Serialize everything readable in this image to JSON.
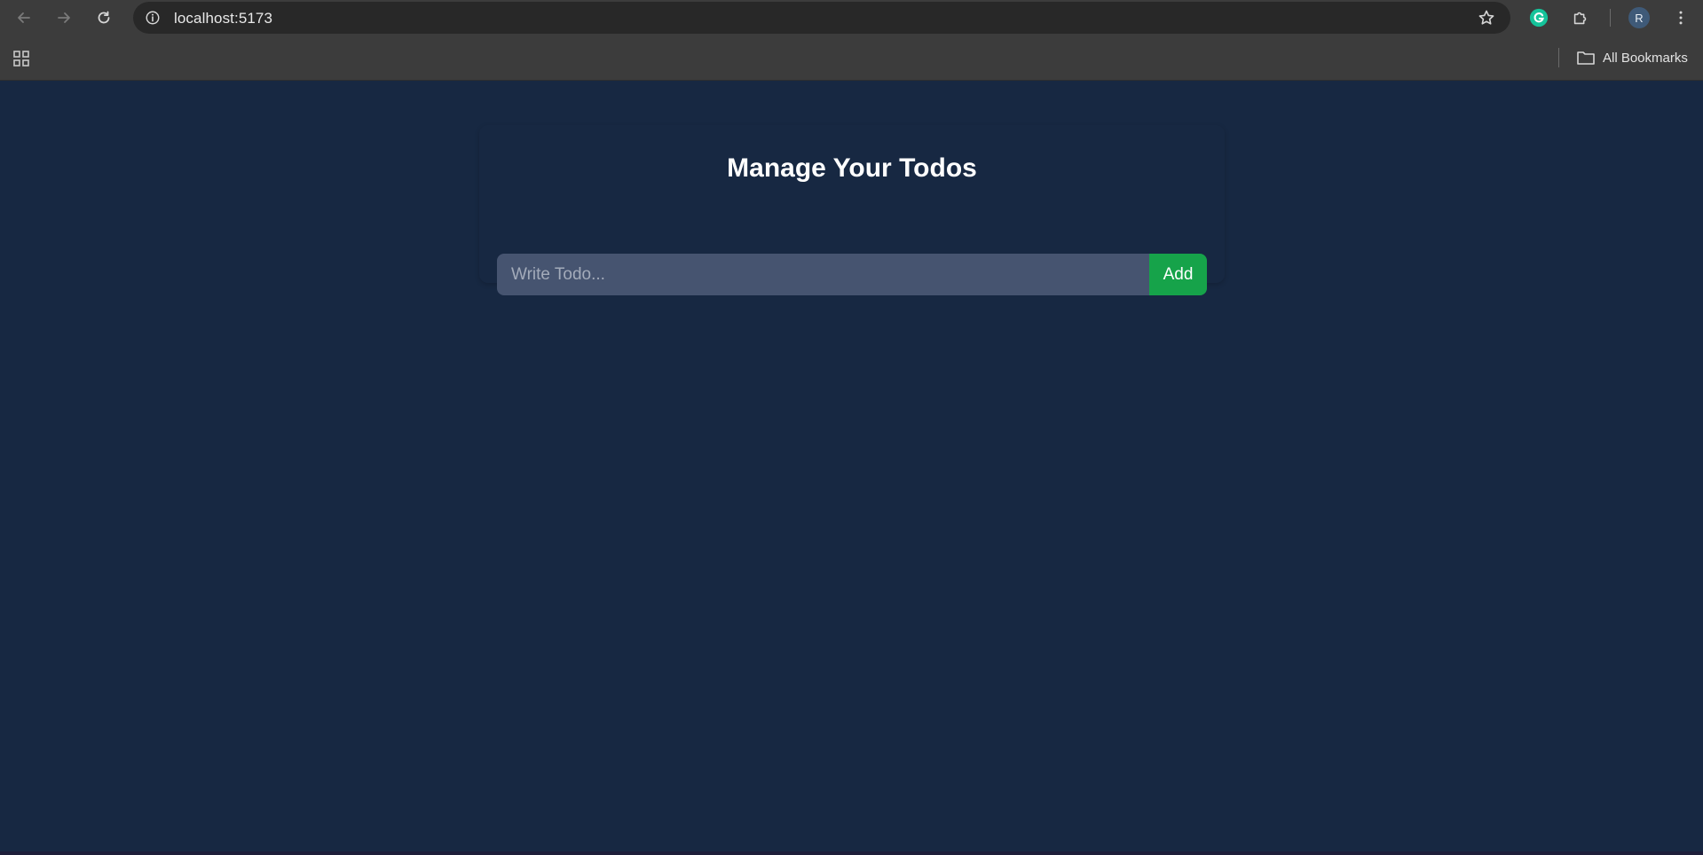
{
  "browser": {
    "url": "localhost:5173",
    "profile_initial": "R",
    "bookmarks_label": "All Bookmarks",
    "icons": {
      "back": "arrow-left-icon",
      "forward": "arrow-right-icon",
      "reload": "reload-icon",
      "site_info": "info-icon",
      "bookmark_star": "star-icon",
      "grammarly": "grammarly-icon",
      "extensions": "puzzle-icon",
      "menu": "kebab-menu-icon",
      "apps": "apps-grid-icon",
      "folder": "folder-icon"
    }
  },
  "app": {
    "title": "Manage Your Todos",
    "input": {
      "placeholder": "Write Todo...",
      "value": ""
    },
    "add_label": "Add"
  },
  "colors": {
    "page_background": "#172842",
    "input_background": "#465470",
    "add_button": "#16a34a",
    "title_text": "#ffffff"
  }
}
